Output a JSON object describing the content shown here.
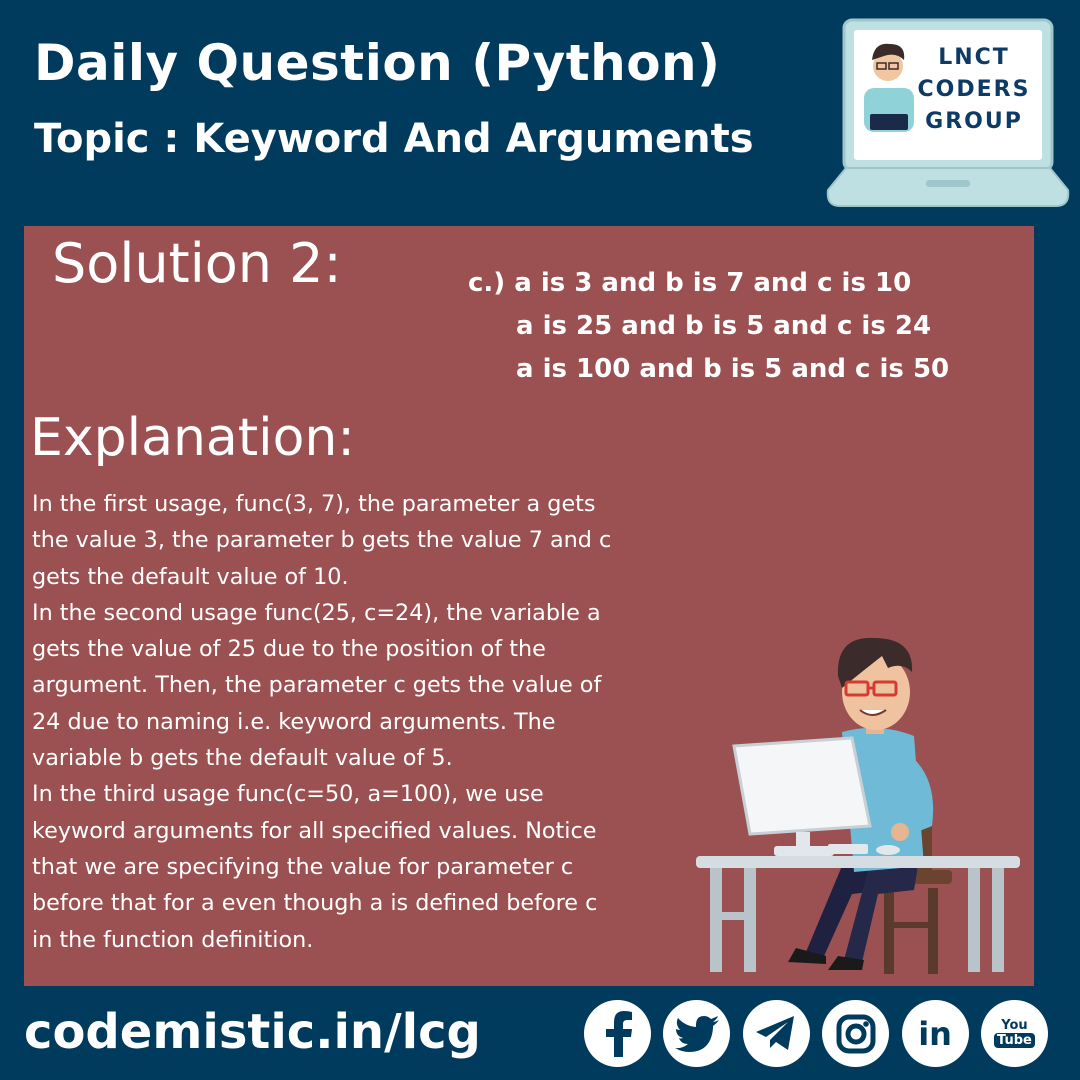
{
  "header": {
    "title": "Daily Question (Python)",
    "subtitle": "Topic :  Keyword And Arguments"
  },
  "logo": {
    "line1": "LNCT",
    "line2": "CODERS",
    "line3": "GROUP"
  },
  "solution": {
    "title": "Solution 2:",
    "answer_lines": [
      "c.)  a is 3 and b is 7 and c is 10",
      "a is 25 and b is 5 and c is 24",
      "a is 100 and b is 5 and c is 50"
    ]
  },
  "explanation": {
    "title": "Explanation:",
    "lines": [
      "In the first usage, func(3, 7), the parameter a gets",
      "the value 3, the parameter b gets the value 7 and c",
      "gets the default value of 10.",
      "In the second usage func(25, c=24), the variable a",
      "gets the value of 25 due to the position of the",
      "argument. Then, the parameter c gets the value of",
      "24 due to naming i.e. keyword arguments. The",
      "variable b gets the default value of 5.",
      "In the third usage func(c=50, a=100), we use",
      "keyword arguments for all specified values. Notice",
      "that we are specifying the value for parameter c",
      "before that for a even though a is defined before c",
      "in the function definition."
    ]
  },
  "footer": {
    "url": "codemistic.in/lcg",
    "youtube_top": "You",
    "youtube_bottom": "Tube",
    "linkedin": "in"
  },
  "colors": {
    "background": "#003a5c",
    "panel": "#9b5152",
    "text": "#ffffff",
    "logo_text": "#0d3b66"
  }
}
